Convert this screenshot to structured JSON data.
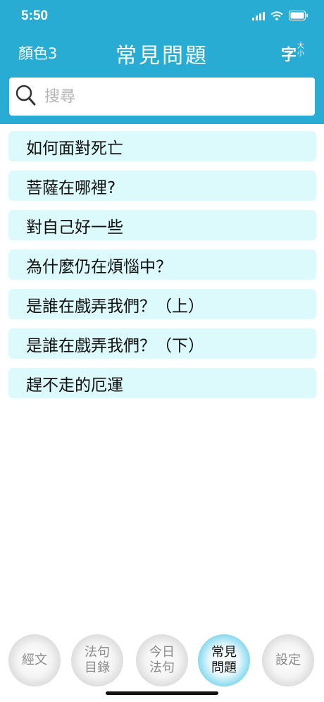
{
  "status": {
    "time": "5:50"
  },
  "nav": {
    "left_label": "顏色3",
    "title": "常見問題",
    "font_size_big": "字",
    "font_size_small_top": "大",
    "font_size_small_bottom": "小"
  },
  "search": {
    "placeholder": "搜尋",
    "value": ""
  },
  "items": [
    {
      "label": "如何面對死亡"
    },
    {
      "label": "菩薩在哪裡?"
    },
    {
      "label": "對自己好一些"
    },
    {
      "label": "為什麼仍在煩惱中？"
    },
    {
      "label": "是誰在戲弄我們？（上）"
    },
    {
      "label": "是誰在戲弄我們？（下）"
    },
    {
      "label": "趕不走的厄運"
    }
  ],
  "tabs": [
    {
      "line1": "經文",
      "line2": ""
    },
    {
      "line1": "法句",
      "line2": "目錄"
    },
    {
      "line1": "今日",
      "line2": "法句"
    },
    {
      "line1": "常見",
      "line2": "問題"
    },
    {
      "line1": "設定",
      "line2": ""
    }
  ],
  "colors": {
    "accent": "#29acd3",
    "item_background": "#dcf9fb"
  }
}
